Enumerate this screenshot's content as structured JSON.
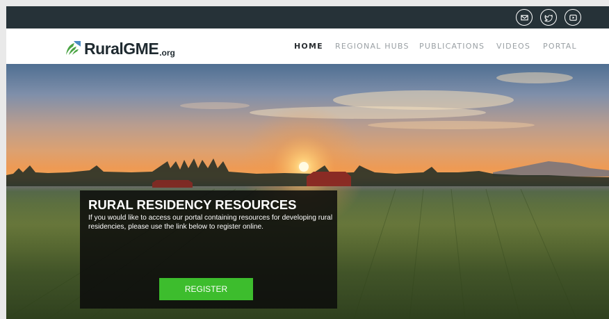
{
  "header": {
    "social_icons": [
      "email-icon",
      "twitter-icon",
      "youtube-icon"
    ],
    "background_color": "#263238"
  },
  "logo": {
    "name": "RuralGME",
    "suffix": ".org",
    "icon": "leaf-icon",
    "colors": [
      "#4a8bc2",
      "#4aa443",
      "#1f2a30"
    ]
  },
  "nav": {
    "items": [
      {
        "label": "HOME",
        "active": true
      },
      {
        "label": "REGIONAL HUBS",
        "active": false
      },
      {
        "label": "PUBLICATIONS",
        "active": false
      },
      {
        "label": "VIDEOS",
        "active": false
      },
      {
        "label": "PORTAL",
        "active": false
      }
    ]
  },
  "hero": {
    "title": "RURAL RESIDENCY RESOURCES",
    "text": "If you would like to access our portal containing resources for developing rural residencies, please use the link below to register online.",
    "button_label": "REGISTER",
    "button_color": "#3dbd2d"
  }
}
